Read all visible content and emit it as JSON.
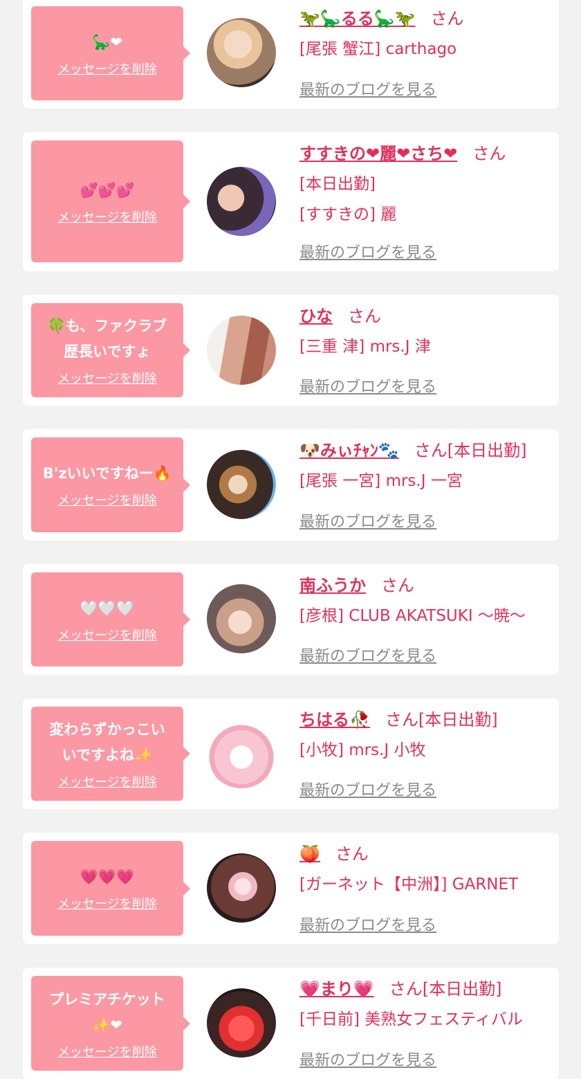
{
  "colors": {
    "page_bg": "#f2f2f2",
    "card_bg": "#ffffff",
    "bubble_bg": "#fc98a3",
    "accent_pink": "#e0305a",
    "muted_gray": "#8a8a8a"
  },
  "entries": [
    {
      "message": "🦕❤",
      "delete_label": "メッセージを削除",
      "name": "🦖🦕るる🦕🦖",
      "honorific": "さん",
      "shop_lines": [
        "[尾張 蟹江] carthago"
      ],
      "blog_label": "最新のブログを見る",
      "avatar_icon": "woman-selfie-photo"
    },
    {
      "message": "💕💕💕",
      "delete_label": "メッセージを削除",
      "name": "すすきの❤麗❤さち❤",
      "honorific": "さん",
      "shop_lines": [
        "[本日出勤]",
        "[すすきの] 麗"
      ],
      "blog_label": "最新のブログを見る",
      "avatar_icon": "woman-with-balloon-photo"
    },
    {
      "message": "🍀も、ファクラブ\n歴長いですょ",
      "delete_label": "メッセージを削除",
      "name": "ひな",
      "honorific": "さん",
      "shop_lines": [
        "[三重 津] mrs.J 津"
      ],
      "blog_label": "最新のブログを見る",
      "avatar_icon": "hair-closeup-photo"
    },
    {
      "message": "B'zいいですねー🔥",
      "delete_label": "メッセージを削除",
      "name": "🐶みぃﾁｬﾝ🐾",
      "honorific": "さん[本日出勤]",
      "shop_lines": [
        "[尾張 一宮] mrs.J 一宮"
      ],
      "blog_label": "最新のブログを見る",
      "avatar_icon": "woman-with-dog-filter-photo"
    },
    {
      "message": "🤍🤍🤍",
      "delete_label": "メッセージを削除",
      "name": "南ふうか",
      "honorific": "さん",
      "shop_lines": [
        "[彦根] CLUB AKATSUKI 〜暁〜"
      ],
      "blog_label": "最新のブログを見る",
      "avatar_icon": "woman-portrait-photo"
    },
    {
      "message": "変わらずかっこい\nいですよね✨",
      "delete_label": "メッセージを削除",
      "name": "ちはる🥀",
      "honorific": "さん[本日出勤]",
      "shop_lines": [
        "[小牧] mrs.J 小牧"
      ],
      "blog_label": "最新のブログを見る",
      "avatar_icon": "my-melody-plush-photo"
    },
    {
      "message": "💗💗💗",
      "delete_label": "メッセージを削除",
      "name": "🍑",
      "honorific": "さん",
      "shop_lines": [
        "[ガーネット【中洲】] GARNET"
      ],
      "blog_label": "最新のブログを見る",
      "avatar_icon": "woman-with-peach-sticker-photo"
    },
    {
      "message": "プレミアチケット\n✨❤",
      "delete_label": "メッセージを削除",
      "name": "💗まり💗",
      "honorific": "さん[本日出勤]",
      "shop_lines": [
        "[千日前] 美熟女フェスティバル"
      ],
      "blog_label": "最新のブログを見る",
      "avatar_icon": "heart-face-sticker-photo"
    }
  ]
}
